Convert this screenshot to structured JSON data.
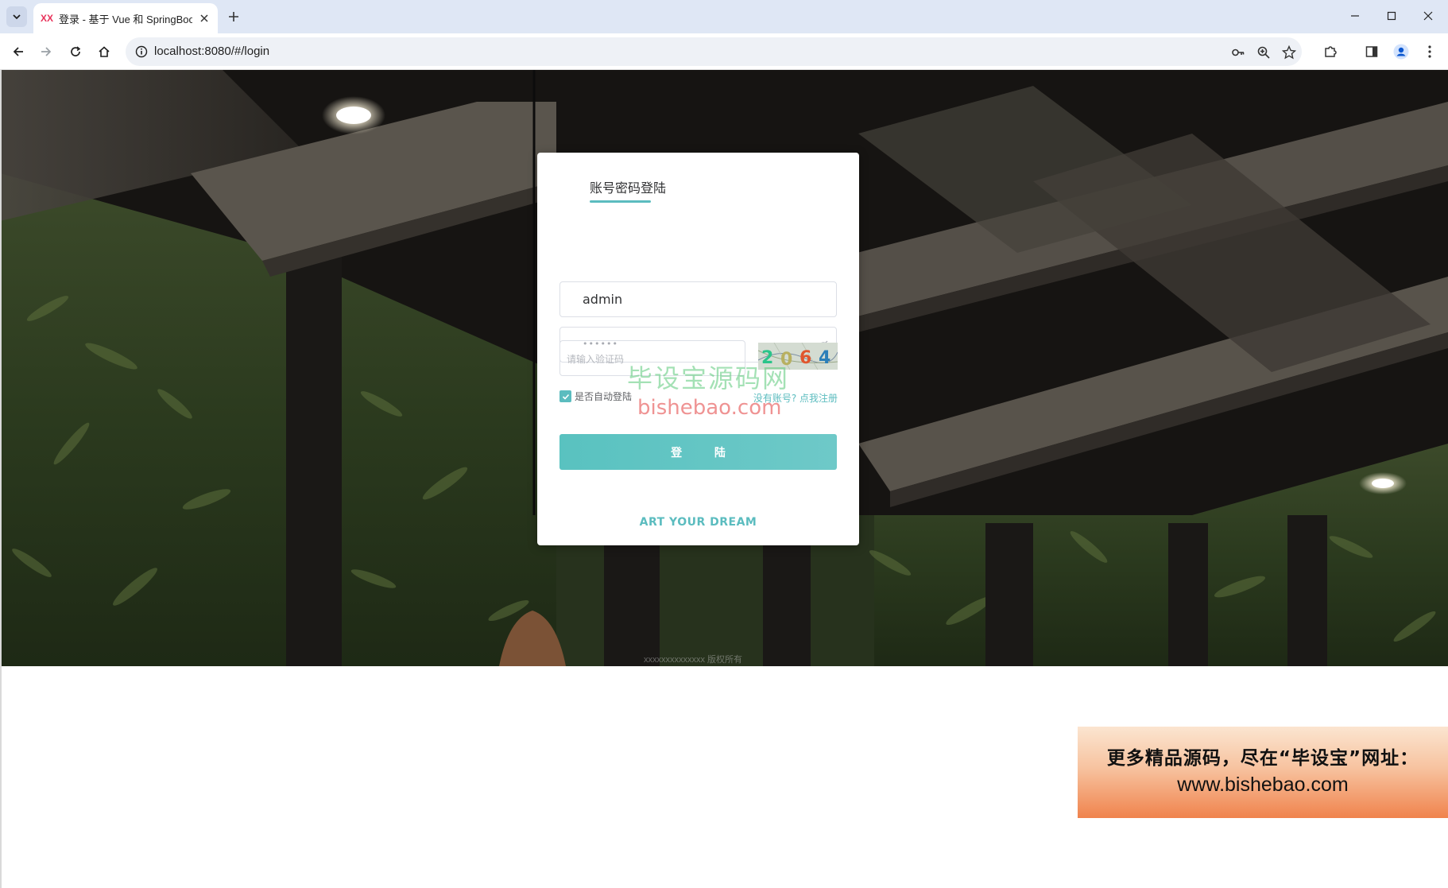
{
  "browser": {
    "tab_title": "登录 - 基于 Vue 和 SpringBoot",
    "tab_favicon_text": "XX",
    "url": "localhost:8080/#/login"
  },
  "login": {
    "tab_label": "账号密码登陆",
    "username_value": "admin",
    "password_dots": "••••••",
    "captcha_placeholder": "请输入验证码",
    "captcha_code": [
      "2",
      "0",
      "6",
      "4"
    ],
    "captcha_colors": [
      "#2bc48a",
      "#b8b060",
      "#e0562e",
      "#2c7fb8"
    ],
    "remember_label": "是否自动登陆",
    "register_link": "没有账号? 点我注册",
    "login_button": "登 陆",
    "slogan": "ART YOUR DREAM",
    "accent_color": "#5bbcbf"
  },
  "footer": {
    "text": "xxxxxxxxxxxxxx 版权所有"
  },
  "watermark": {
    "cn": "毕设宝源码网",
    "en": "bishebao.com"
  },
  "ad": {
    "line1": "更多精品源码，尽在“毕设宝”网址：",
    "line2": "www.bishebao.com"
  }
}
